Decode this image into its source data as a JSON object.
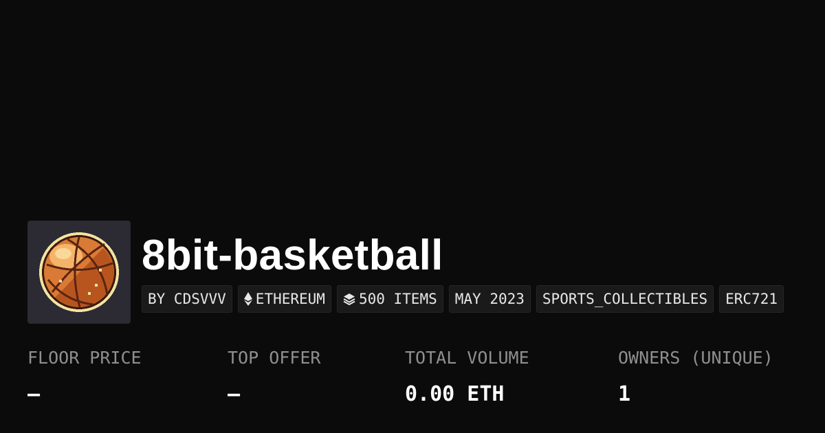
{
  "collection": {
    "name": "8bit-basketball",
    "avatar_icon": "pixel-basketball-icon"
  },
  "tags": [
    {
      "label": "BY CDSVVV",
      "icon": null
    },
    {
      "label": "ETHEREUM",
      "icon": "ethereum-icon"
    },
    {
      "label": "500 ITEMS",
      "icon": "layers-icon"
    },
    {
      "label": "MAY 2023",
      "icon": null
    },
    {
      "label": "SPORTS_COLLECTIBLES",
      "icon": null
    },
    {
      "label": "ERC721",
      "icon": null
    }
  ],
  "stats": [
    {
      "label": "FLOOR PRICE",
      "value": "–"
    },
    {
      "label": "TOP OFFER",
      "value": "–"
    },
    {
      "label": "TOTAL VOLUME",
      "value": "0.00 ETH"
    },
    {
      "label": "OWNERS (UNIQUE)",
      "value": "1"
    }
  ],
  "colors": {
    "background": "#0b0b0b",
    "text": "#ffffff",
    "muted": "#8f8f8f",
    "tag_bg": "#1a1a1a",
    "ball_orange": "#d97a36",
    "ball_outline": "#f2e3a0"
  }
}
